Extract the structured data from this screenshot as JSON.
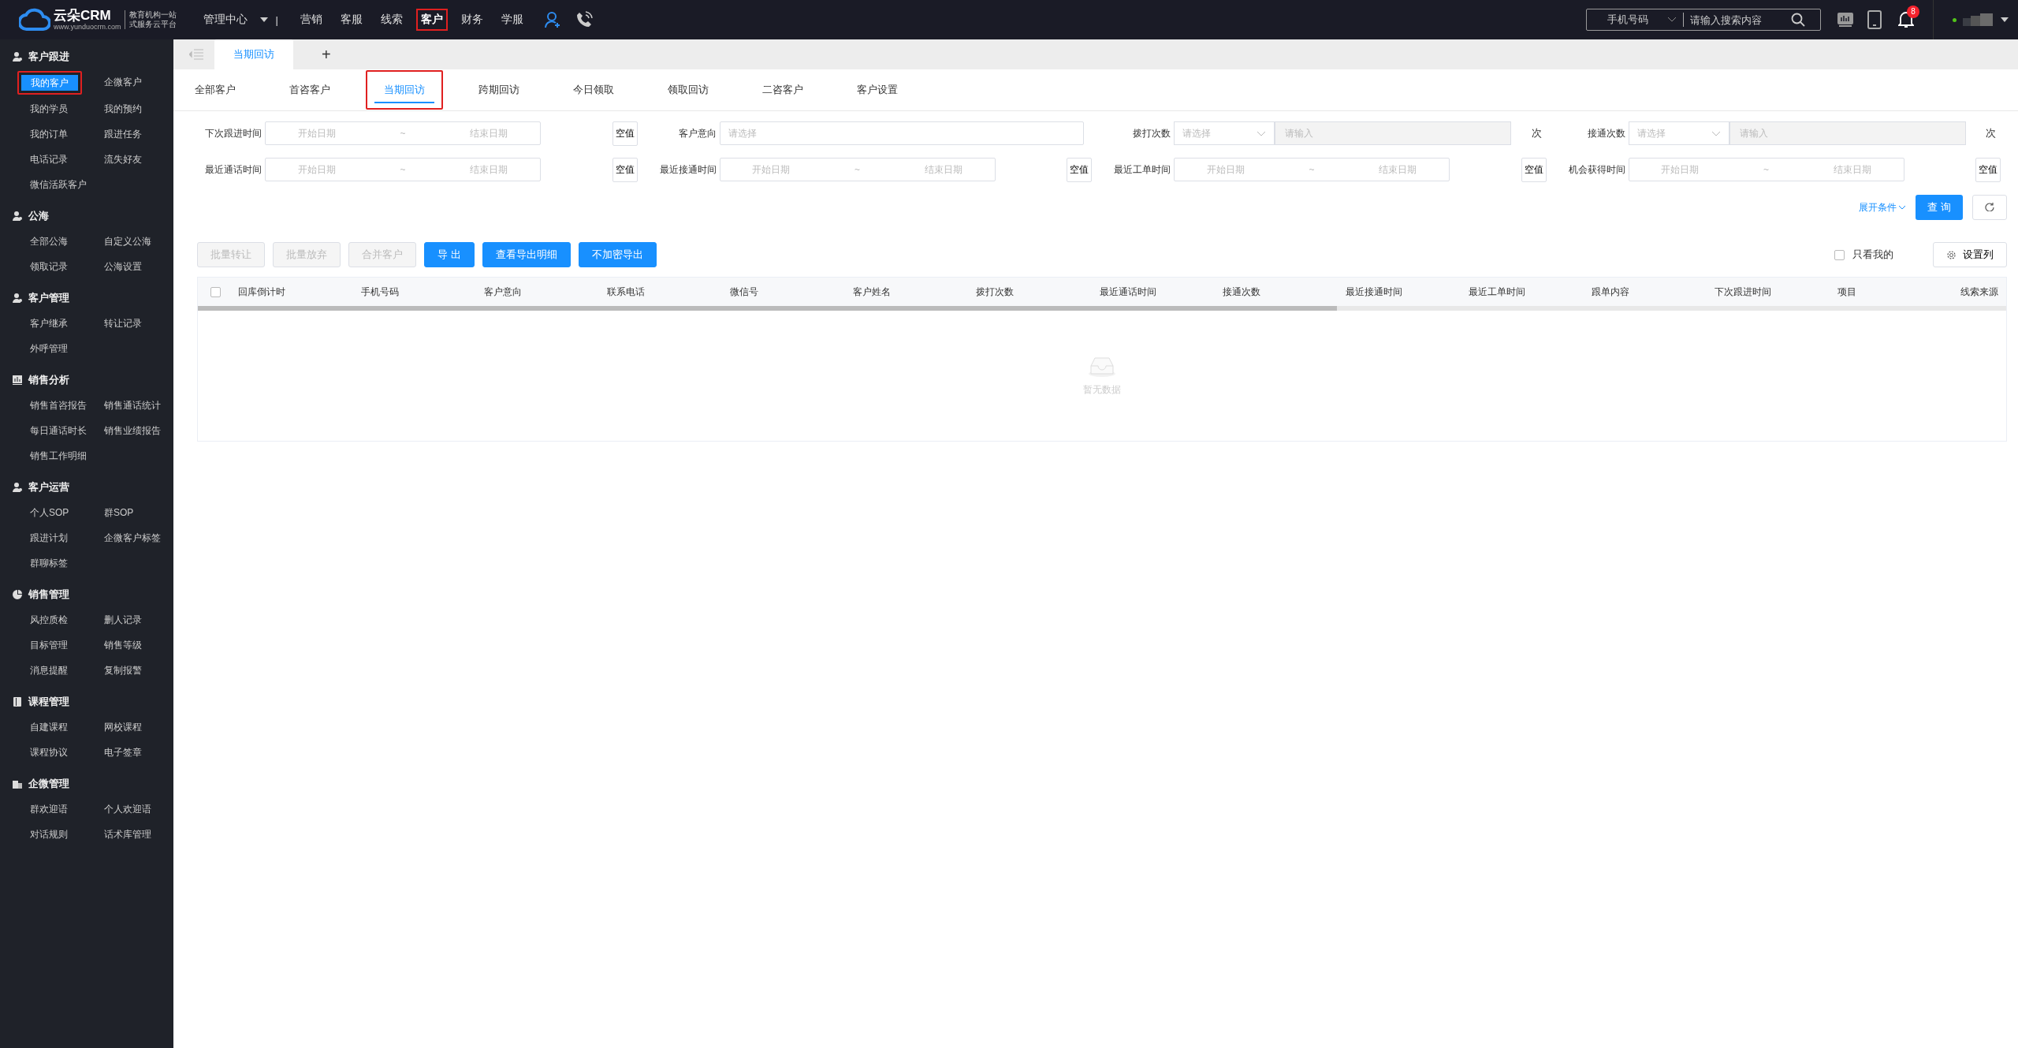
{
  "topbar": {
    "logo": {
      "name": "云朵CRM",
      "url": "www.yunduocrm.com",
      "slogan_1": "教育机构一站",
      "slogan_2": "式服务云平台"
    },
    "menu": "管理中心",
    "divider": "|",
    "nav": [
      {
        "label": "营销",
        "selected": false,
        "highlighted": false
      },
      {
        "label": "客服",
        "selected": false,
        "highlighted": false
      },
      {
        "label": "线索",
        "selected": false,
        "highlighted": false
      },
      {
        "label": "客户",
        "selected": true,
        "highlighted": true
      },
      {
        "label": "财务",
        "selected": false,
        "highlighted": false
      },
      {
        "label": "学服",
        "selected": false,
        "highlighted": false
      }
    ],
    "search": {
      "type": "手机号码",
      "placeholder": "请输入搜索内容"
    },
    "notifications": "8"
  },
  "sidebar": [
    {
      "title": "客户跟进",
      "items": [
        {
          "label": "我的客户",
          "selected": true,
          "highlighted": true
        },
        {
          "label": "企微客户",
          "selected": false,
          "highlighted": false
        },
        {
          "label": "我的学员",
          "selected": false,
          "highlighted": false
        },
        {
          "label": "我的预约",
          "selected": false,
          "highlighted": false
        },
        {
          "label": "我的订单",
          "selected": false,
          "highlighted": false
        },
        {
          "label": "跟进任务",
          "selected": false,
          "highlighted": false
        },
        {
          "label": "电话记录",
          "selected": false,
          "highlighted": false
        },
        {
          "label": "流失好友",
          "selected": false,
          "highlighted": false
        },
        {
          "label": "微信活跃客户",
          "selected": false,
          "highlighted": false
        }
      ]
    },
    {
      "title": "公海",
      "items": [
        {
          "label": "全部公海",
          "selected": false,
          "highlighted": false
        },
        {
          "label": "自定义公海",
          "selected": false,
          "highlighted": false
        },
        {
          "label": "领取记录",
          "selected": false,
          "highlighted": false
        },
        {
          "label": "公海设置",
          "selected": false,
          "highlighted": false
        }
      ]
    },
    {
      "title": "客户管理",
      "items": [
        {
          "label": "客户继承",
          "selected": false,
          "highlighted": false
        },
        {
          "label": "转让记录",
          "selected": false,
          "highlighted": false
        },
        {
          "label": "外呼管理",
          "selected": false,
          "highlighted": false
        }
      ]
    },
    {
      "title": "销售分析",
      "items": [
        {
          "label": "销售首咨报告",
          "selected": false,
          "highlighted": false
        },
        {
          "label": "销售通话统计",
          "selected": false,
          "highlighted": false
        },
        {
          "label": "每日通话时长",
          "selected": false,
          "highlighted": false
        },
        {
          "label": "销售业绩报告",
          "selected": false,
          "highlighted": false
        },
        {
          "label": "销售工作明细",
          "selected": false,
          "highlighted": false
        }
      ]
    },
    {
      "title": "客户运营",
      "items": [
        {
          "label": "个人SOP",
          "selected": false,
          "highlighted": false
        },
        {
          "label": "群SOP",
          "selected": false,
          "highlighted": false
        },
        {
          "label": "跟进计划",
          "selected": false,
          "highlighted": false
        },
        {
          "label": "企微客户标签",
          "selected": false,
          "highlighted": false
        },
        {
          "label": "群聊标签",
          "selected": false,
          "highlighted": false
        }
      ]
    },
    {
      "title": "销售管理",
      "items": [
        {
          "label": "风控质检",
          "selected": false,
          "highlighted": false
        },
        {
          "label": "删人记录",
          "selected": false,
          "highlighted": false
        },
        {
          "label": "目标管理",
          "selected": false,
          "highlighted": false
        },
        {
          "label": "销售等级",
          "selected": false,
          "highlighted": false
        },
        {
          "label": "消息提醒",
          "selected": false,
          "highlighted": false
        },
        {
          "label": "复制报警",
          "selected": false,
          "highlighted": false
        }
      ]
    },
    {
      "title": "课程管理",
      "items": [
        {
          "label": "自建课程",
          "selected": false,
          "highlighted": false
        },
        {
          "label": "网校课程",
          "selected": false,
          "highlighted": false
        },
        {
          "label": "课程协议",
          "selected": false,
          "highlighted": false
        },
        {
          "label": "电子签章",
          "selected": false,
          "highlighted": false
        }
      ]
    },
    {
      "title": "企微管理",
      "items": [
        {
          "label": "群欢迎语",
          "selected": false,
          "highlighted": false
        },
        {
          "label": "个人欢迎语",
          "selected": false,
          "highlighted": false
        },
        {
          "label": "对话规则",
          "selected": false,
          "highlighted": false
        },
        {
          "label": "话术库管理",
          "selected": false,
          "highlighted": false
        }
      ]
    }
  ],
  "page_tabs": [
    {
      "label": "当期回访",
      "selected": true
    }
  ],
  "add_tab": "+",
  "sub_tabs": [
    {
      "label": "全部客户",
      "selected": false,
      "highlighted": false
    },
    {
      "label": "首咨客户",
      "selected": false,
      "highlighted": false
    },
    {
      "label": "当期回访",
      "selected": true,
      "highlighted": true
    },
    {
      "label": "跨期回访",
      "selected": false,
      "highlighted": false
    },
    {
      "label": "今日领取",
      "selected": false,
      "highlighted": false
    },
    {
      "label": "领取回访",
      "selected": false,
      "highlighted": false
    },
    {
      "label": "二咨客户",
      "selected": false,
      "highlighted": false
    },
    {
      "label": "客户设置",
      "selected": false,
      "highlighted": false
    }
  ],
  "filters": [
    {
      "kind": "date_range",
      "label": "下次跟进时间",
      "start": "开始日期",
      "separator": "~",
      "end": "结束日期",
      "null_button": "空值"
    },
    {
      "kind": "select",
      "label": "客户意向",
      "placeholder": "请选择"
    },
    {
      "kind": "count",
      "label": "拨打次数",
      "select": "请选择",
      "placeholder": "请输入",
      "unit": "次"
    },
    {
      "kind": "count",
      "label": "接通次数",
      "select": "请选择",
      "placeholder": "请输入",
      "unit": "次"
    },
    {
      "kind": "date_range",
      "label": "最近通话时间",
      "start": "开始日期",
      "separator": "~",
      "end": "结束日期",
      "null_button": "空值"
    },
    {
      "kind": "date_range",
      "label": "最近接通时间",
      "start": "开始日期",
      "separator": "~",
      "end": "结束日期",
      "null_button": "空值"
    },
    {
      "kind": "date_range",
      "label": "最近工单时间",
      "start": "开始日期",
      "separator": "~",
      "end": "结束日期",
      "null_button": "空值"
    },
    {
      "kind": "date_range",
      "label": "机会获得时间",
      "start": "开始日期",
      "separator": "~",
      "end": "结束日期",
      "null_button": "空值"
    }
  ],
  "expand_link": "展开条件",
  "query_button": "查 询",
  "actions": [
    {
      "label": "批量转让",
      "disabled": true
    },
    {
      "label": "批量放弃",
      "disabled": true
    },
    {
      "label": "合并客户",
      "disabled": true
    },
    {
      "label": "导 出",
      "disabled": false
    },
    {
      "label": "查看导出明细",
      "disabled": false
    },
    {
      "label": "不加密导出",
      "disabled": false
    }
  ],
  "only_mine": {
    "label": "只看我的",
    "checked": false
  },
  "columns_button": "设置列",
  "table": {
    "select_all": false,
    "columns": [
      "回库倒计时",
      "手机号码",
      "客户意向",
      "联系电话",
      "微信号",
      "客户姓名",
      "拨打次数",
      "最近通话时间",
      "接通次数",
      "最近接通时间",
      "最近工单时间",
      "跟单内容",
      "下次跟进时间",
      "项目",
      "线索来源"
    ],
    "empty_text": "暂无数据"
  }
}
